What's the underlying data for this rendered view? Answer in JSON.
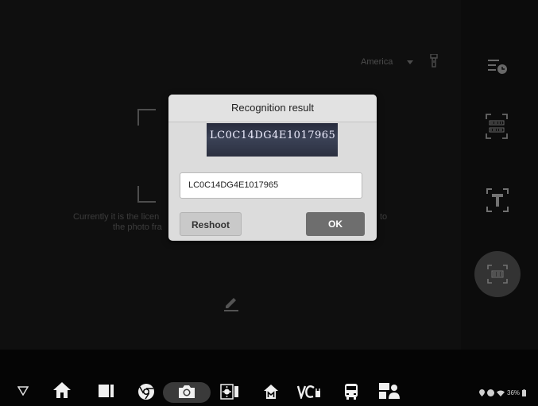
{
  "camera": {
    "region_label": "America",
    "hint_line1": "Currently it is the licen",
    "hint_line2": "the photo fra",
    "hint_right_frag": "to"
  },
  "dialog": {
    "title": "Recognition result",
    "plate_image_text": "LC0C14DG4E1017965",
    "vin_value": "LC0C14DG4E1017965",
    "reshoot_label": "Reshoot",
    "ok_label": "OK"
  },
  "rail": {
    "icons": [
      "history-icon",
      "barcode-scan-icon",
      "text-scan-icon",
      "shutter-icon"
    ]
  },
  "status_bar": {
    "battery_text": "36%"
  }
}
